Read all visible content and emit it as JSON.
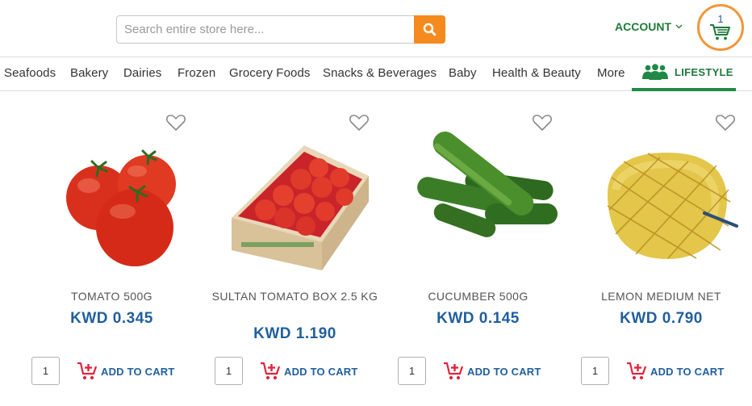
{
  "header": {
    "search_placeholder": "Search entire store here...",
    "account_label": "ACCOUNT",
    "cart_count": "1"
  },
  "nav": {
    "items": [
      "Seafoods",
      "Bakery",
      "Dairies",
      "Frozen",
      "Grocery Foods",
      "Snacks & Beverages",
      "Baby",
      "Health & Beauty",
      "More"
    ],
    "lifestyle_label": "LIFESTYLE"
  },
  "products": [
    {
      "name": "TOMATO 500G",
      "price": "KWD 0.345",
      "qty": "1",
      "add_label": "ADD TO CART"
    },
    {
      "name": "SULTAN TOMATO BOX 2.5 KG",
      "price": "KWD 1.190",
      "qty": "1",
      "add_label": "ADD TO CART"
    },
    {
      "name": "CUCUMBER 500G",
      "price": "KWD 0.145",
      "qty": "1",
      "add_label": "ADD TO CART"
    },
    {
      "name": "LEMON MEDIUM NET",
      "price": "KWD 0.790",
      "qty": "1",
      "add_label": "ADD TO CART"
    }
  ],
  "colors": {
    "accent_orange": "#f58a1f",
    "brand_green": "#1f7a3a",
    "price_blue": "#1f5f9e",
    "cart_red": "#e0243b"
  },
  "icons": {
    "search": "search-icon",
    "cart": "cart-icon",
    "account_chevron": "chevron-down-icon",
    "lifestyle": "people-icon",
    "wishlist": "heart-icon",
    "add_to_cart": "cart-plus-icon"
  }
}
